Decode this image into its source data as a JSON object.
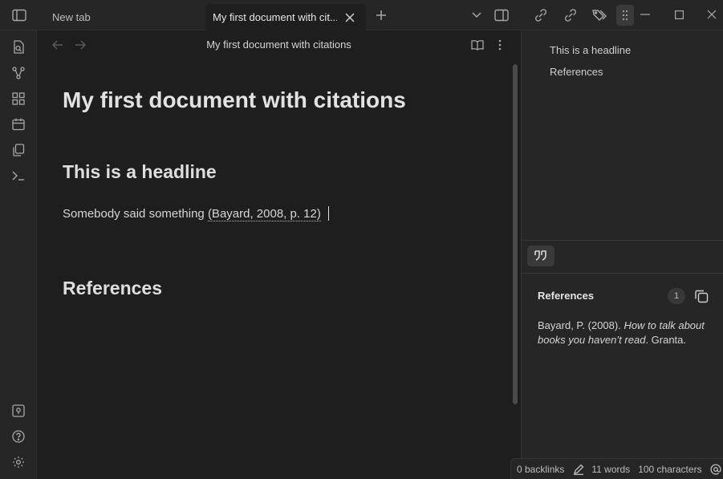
{
  "tabs": [
    {
      "label": "New tab"
    },
    {
      "label": "My first document with cit..."
    }
  ],
  "view": {
    "title": "My first document with citations"
  },
  "document": {
    "h1": "My first document with citations",
    "h2_headline": "This is a headline",
    "paragraph_text": "Somebody said something ",
    "citation": "(Bayard, 2008, p. 12)",
    "h2_references": "References"
  },
  "outline": {
    "items": [
      {
        "label": "This is a headline"
      },
      {
        "label": "References"
      }
    ]
  },
  "references_panel": {
    "title": "References",
    "count": "1",
    "entry": {
      "author_year": "Bayard, P. (2008). ",
      "title_italic": "How to talk about books you haven’t read",
      "publisher": ". Granta."
    }
  },
  "status": {
    "backlinks": "0 backlinks",
    "words": "11 words",
    "characters": "100 characters"
  },
  "icons": {
    "sidebar_left": "sidebar-toggle-icon",
    "new_tab": "plus-icon",
    "tab_list": "chevron-down-icon",
    "sidebar_right": "sidebar-right-toggle-icon",
    "ribbon": [
      "file-search-icon",
      "graph-icon",
      "grid-icon",
      "calendar-icon",
      "copy-icon",
      "terminal-icon",
      "vault-icon",
      "help-icon",
      "settings-icon"
    ]
  },
  "colors": {
    "background": "#1e1e1e",
    "panel": "#262626",
    "accent": "#2a6fb0"
  }
}
